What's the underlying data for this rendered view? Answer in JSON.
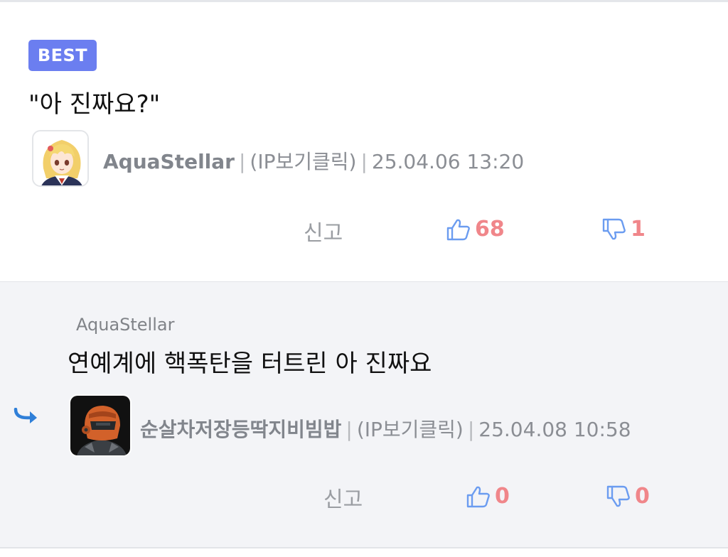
{
  "comments": [
    {
      "badge": "BEST",
      "text": "\"아 진짜요?\"",
      "author": "AquaStellar",
      "ip_link": "(IP보기클릭)",
      "datetime": "25.04.06 13:20",
      "report_label": "신고",
      "likes": "68",
      "dislikes": "1",
      "avatar": "anime-girl-avatar"
    },
    {
      "reply_to": "AquaStellar",
      "text": "연예계에 핵폭탄을 터트린 아 진짜요",
      "author": "순살차저장등딱지비빔밥",
      "ip_link": "(IP보기클릭)",
      "datetime": "25.04.08 10:58",
      "report_label": "신고",
      "likes": "0",
      "dislikes": "0",
      "avatar": "armored-helmet-avatar"
    }
  ],
  "colors": {
    "badge": "#6b7ef0",
    "vote_count": "#f0868a",
    "vote_icon": "#6b9cf0",
    "reply_arrow": "#2f7fd8"
  }
}
